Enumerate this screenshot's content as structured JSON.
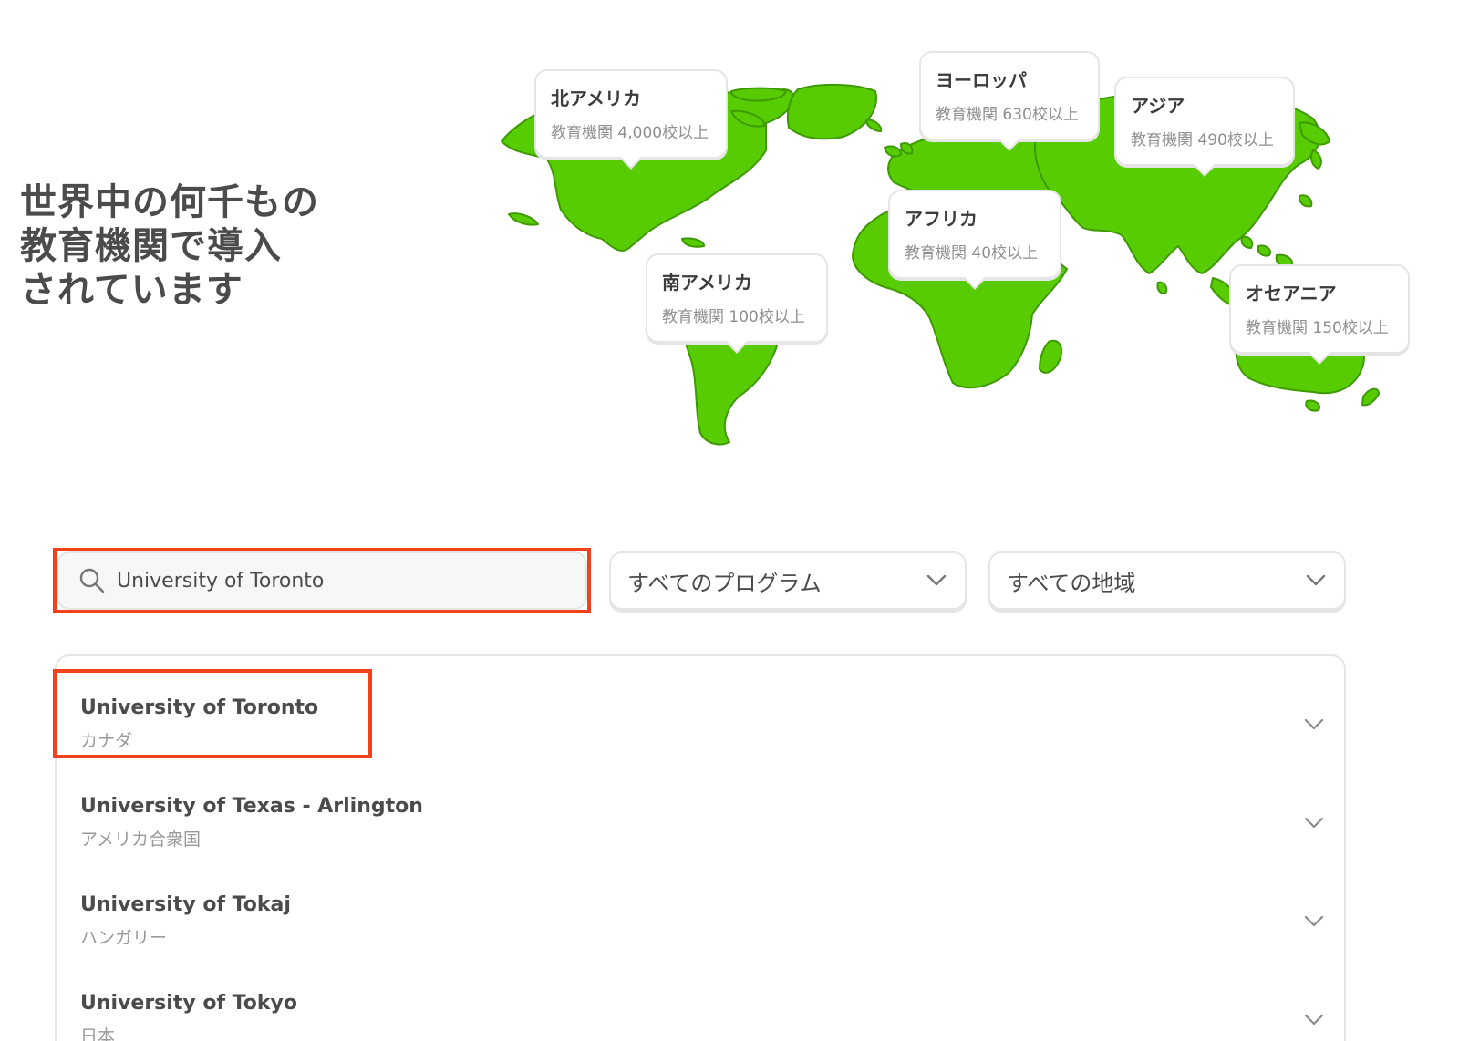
{
  "headline": {
    "line1": "世界中の何千もの",
    "line2": "教育機関で導入",
    "line3": "されています"
  },
  "map": {
    "land_color": "#58cc02",
    "regions": [
      {
        "name": "北アメリカ",
        "count": "教育機関 4,000校以上"
      },
      {
        "name": "ヨーロッパ",
        "count": "教育機関 630校以上"
      },
      {
        "name": "アジア",
        "count": "教育機関 490校以上"
      },
      {
        "name": "アフリカ",
        "count": "教育機関 40校以上"
      },
      {
        "name": "南アメリカ",
        "count": "教育機関 100校以上"
      },
      {
        "name": "オセアニア",
        "count": "教育機関 150校以上"
      }
    ]
  },
  "search": {
    "value": "University of Toronto",
    "icon": "search-icon"
  },
  "filters": {
    "program": "すべてのプログラム",
    "region": "すべての地域"
  },
  "results": [
    {
      "name": "University of Toronto",
      "country": "カナダ"
    },
    {
      "name": "University of Texas - Arlington",
      "country": "アメリカ合衆国"
    },
    {
      "name": "University of Tokaj",
      "country": "ハンガリー"
    },
    {
      "name": "University of Tokyo",
      "country": "日本"
    }
  ],
  "highlight_color": "#f5401c"
}
